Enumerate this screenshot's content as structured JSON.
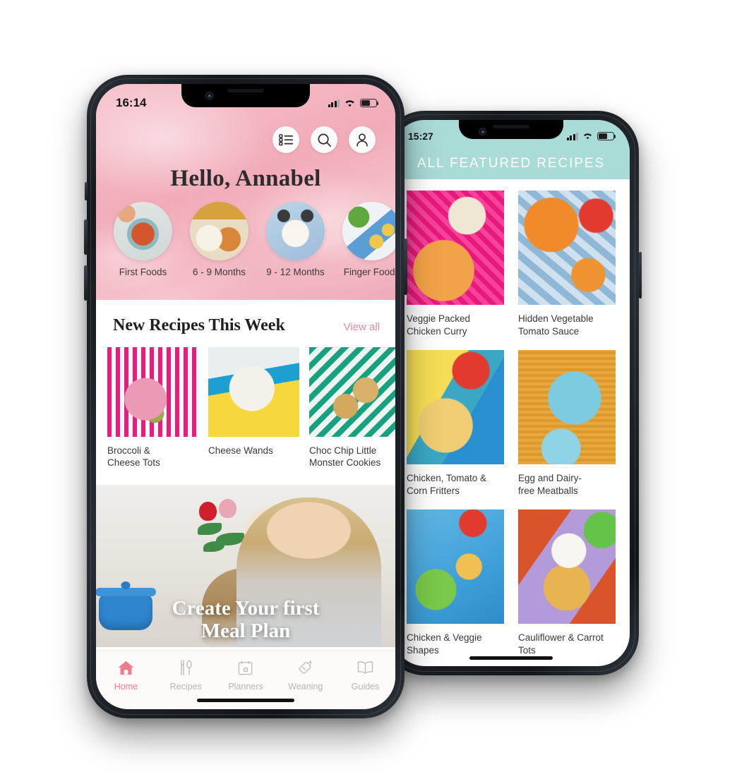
{
  "front_phone": {
    "status_bar": {
      "time": "16:14",
      "signal_icon": "cellular-bars-icon",
      "wifi_icon": "wifi-icon",
      "battery_icon": "battery-icon"
    },
    "header": {
      "greeting": "Hello, Annabel",
      "icons": [
        {
          "name": "list-icon",
          "label": "Shopping List"
        },
        {
          "name": "search-icon",
          "label": "Search"
        },
        {
          "name": "profile-icon",
          "label": "Profile"
        }
      ]
    },
    "categories": [
      {
        "label": "First Foods"
      },
      {
        "label": "6 - 9 Months"
      },
      {
        "label": "9 - 12 Months"
      },
      {
        "label": "Finger Foods"
      }
    ],
    "new_recipes": {
      "title": "New Recipes This Week",
      "view_all": "View all",
      "cards": [
        {
          "title": "Broccoli &\nCheese Tots"
        },
        {
          "title": "Cheese Wands"
        },
        {
          "title": "Choc Chip Little\nMonster Cookies"
        }
      ]
    },
    "promo": {
      "title": "Create Your first\nMeal Plan"
    },
    "tabs": [
      {
        "label": "Home",
        "icon": "house-icon",
        "active": true
      },
      {
        "label": "Recipes",
        "icon": "cutlery-icon",
        "active": false
      },
      {
        "label": "Planners",
        "icon": "calendar-icon",
        "active": false
      },
      {
        "label": "Weaning",
        "icon": "bottle-icon",
        "active": false
      },
      {
        "label": "Guides",
        "icon": "book-icon",
        "active": false
      }
    ]
  },
  "back_phone": {
    "status_bar": {
      "time": "15:27",
      "signal_icon": "cellular-bars-icon",
      "wifi_icon": "wifi-icon",
      "battery_icon": "battery-icon"
    },
    "header": {
      "title": "ALL FEATURED RECIPES"
    },
    "recipes": [
      {
        "title": "Veggie Packed\nChicken Curry"
      },
      {
        "title": "Hidden Vegetable\nTomato Sauce"
      },
      {
        "title": "Chicken, Tomato &\nCorn Fritters"
      },
      {
        "title": "Egg and Dairy-\nfree Meatballs"
      },
      {
        "title": "Chicken & Veggie Shapes"
      },
      {
        "title": "Cauliflower & Carrot Tots"
      }
    ]
  },
  "colors": {
    "hero_pink": "#f1abb9",
    "accent_pink": "#ef7b8f",
    "link_pink": "#e98a9e",
    "teal_header": "#a9dbd7",
    "text_dark": "#2e2b2c",
    "text_body": "#3a3839",
    "tab_inactive": "#b9b2b1"
  }
}
